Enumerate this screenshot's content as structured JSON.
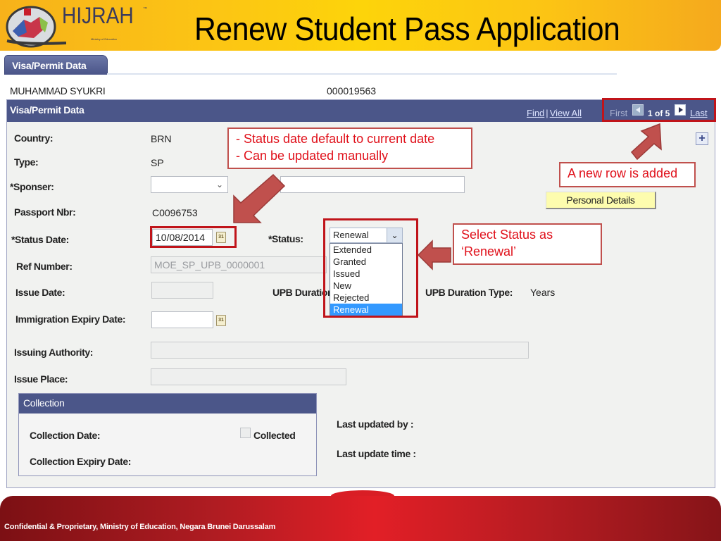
{
  "header": {
    "logo_text": "HIJRAH",
    "logo_tm": "™",
    "logo_subtitle": "Ministry of Education",
    "title": "Renew Student Pass Application"
  },
  "tab": {
    "label": "Visa/Permit Data"
  },
  "person": {
    "name": "MUHAMMAD SYUKRI",
    "id": "000019563"
  },
  "panel": {
    "title": "Visa/Permit Data",
    "find_label": "Find",
    "separator": "|",
    "view_all_label": "View All",
    "nav": {
      "first": "First",
      "count": "1 of 5",
      "last": "Last"
    },
    "add_row_symbol": "+"
  },
  "fields": {
    "country": {
      "label": "Country:",
      "value": "BRN"
    },
    "type": {
      "label": "Type:",
      "value": "SP"
    },
    "sponser": {
      "label": "*Sponser:",
      "value": "",
      "extra_value": ""
    },
    "passport": {
      "label": "Passport Nbr:",
      "value": "C0096753"
    },
    "status_date": {
      "label": "*Status Date:",
      "value": "10/08/2014",
      "calendar_glyph": "31"
    },
    "status": {
      "label": "*Status:",
      "value": "Renewal",
      "dropdown_glyph": "⌄",
      "options": [
        "Extended",
        "Granted",
        "Issued",
        "New",
        "Rejected",
        "Renewal"
      ],
      "selected_index": 5
    },
    "ref_number": {
      "label": "Ref Number:",
      "value": "MOE_SP_UPB_0000001"
    },
    "issue_date": {
      "label": "Issue Date:",
      "value": ""
    },
    "upb_duration": {
      "label": "UPB Duration:"
    },
    "upb_duration_type": {
      "label": "UPB Duration Type:",
      "value": "Years"
    },
    "immigration_expiry": {
      "label": "Immigration Expiry Date:",
      "value": "",
      "calendar_glyph": "31"
    },
    "issuing_authority": {
      "label": "Issuing Authority:",
      "value": ""
    },
    "issue_place": {
      "label": "Issue Place:",
      "value": ""
    }
  },
  "buttons": {
    "personal_details": "Personal Details"
  },
  "collection": {
    "title": "Collection",
    "collection_date_label": "Collection Date:",
    "collected_label": "Collected",
    "collected_checked": false,
    "collection_expiry_label": "Collection Expiry Date:"
  },
  "audit": {
    "last_updated_by_label": "Last updated by :",
    "last_update_time_label": "Last update time :"
  },
  "annotations": {
    "status_date_note_line1": "- Status date default to current date",
    "status_date_note_line2": "- Can be updated manually",
    "new_row_note": "A new row is added",
    "select_status_line1": "Select Status as",
    "select_status_line2": "‘Renewal’"
  },
  "colors": {
    "panel_header": "#4b5689",
    "highlight_red": "#c0141a",
    "annotation_text": "#e0101a",
    "selected_option": "#3399ff",
    "banner_yellow": "#fdd40a",
    "footer_red": "#e21f26"
  },
  "footer": {
    "text": "Confidential & Proprietary, Ministry of Education, Negara Brunei Darussalam"
  }
}
